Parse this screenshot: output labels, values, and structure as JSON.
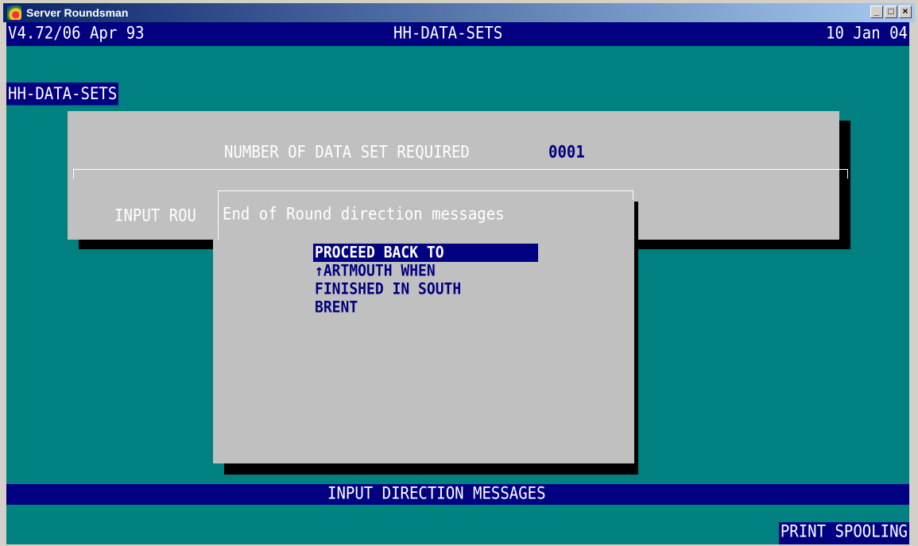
{
  "window": {
    "title": "Server Roundsman",
    "controls": [
      "_",
      "□",
      "×"
    ]
  },
  "header": {
    "version": "V4.72/06 Apr 93",
    "center_title": "HH-DATA-SETS",
    "date": "10 Jan 04"
  },
  "section_title": "HH-DATA-SETS",
  "form": {
    "number_label": "NUMBER OF DATA SET REQUIRED",
    "number_value": "0001",
    "input_label": "INPUT ROU"
  },
  "dialog": {
    "title": "End of Round direction messages",
    "lines": [
      "PROCEED BACK TO",
      "↑ARTMOUTH WHEN",
      "FINISHED IN SOUTH",
      "BRENT"
    ]
  },
  "status_bar": "INPUT DIRECTION MESSAGES",
  "indicator": "PRINT SPOOLING",
  "colors": {
    "terminal_bg": "#008080",
    "bar_bg": "#000080",
    "panel_bg": "#c0c0c0"
  }
}
